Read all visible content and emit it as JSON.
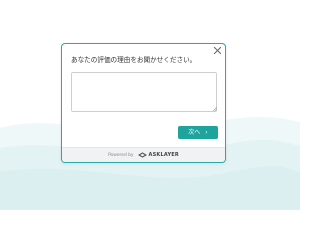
{
  "modal": {
    "question": "あなたの評価の理由をお聞かせください。",
    "input_value": "",
    "next_label": "次へ",
    "next_chevron": "›",
    "close_icon": "close-icon"
  },
  "footer": {
    "powered_by": "Powered by",
    "brand": "ASKLAYER",
    "brand_icon": "asklayer-logo-icon"
  },
  "colors": {
    "accent": "#1ea49c",
    "border": "#2aa7a7",
    "wave": "#e3f3f3"
  }
}
